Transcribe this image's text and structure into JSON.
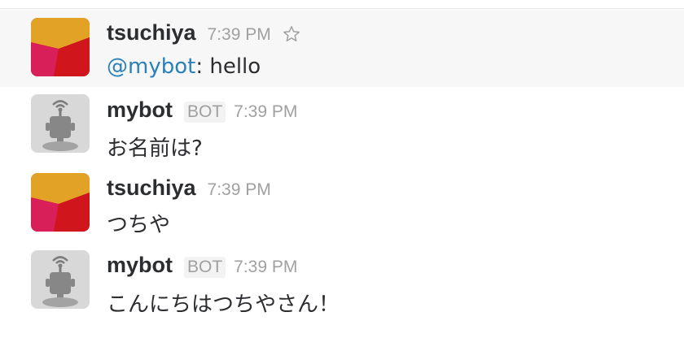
{
  "messages": [
    {
      "username": "tsuchiya",
      "time": "7:39 PM",
      "mention": "@mybot",
      "text": ": hello",
      "highlighted": true,
      "avatar": "tsuchiya-avatar"
    },
    {
      "username": "mybot",
      "badge": "BOT",
      "time": "7:39 PM",
      "text": "お名前は?",
      "avatar": "robot-avatar"
    },
    {
      "username": "tsuchiya",
      "time": "7:39 PM",
      "text": "つちや",
      "avatar": "tsuchiya-avatar"
    },
    {
      "username": "mybot",
      "badge": "BOT",
      "time": "7:39 PM",
      "text": "こんにちはつちやさん！",
      "avatar": "robot-avatar"
    }
  ],
  "colors": {
    "mention": "#2a80b9",
    "username": "#2c2d30",
    "timestamp": "#a0a0a2",
    "highlight_bg": "#f7f7f7"
  },
  "icons": [
    "star-icon",
    "robot-avatar",
    "tsuchiya-avatar"
  ]
}
